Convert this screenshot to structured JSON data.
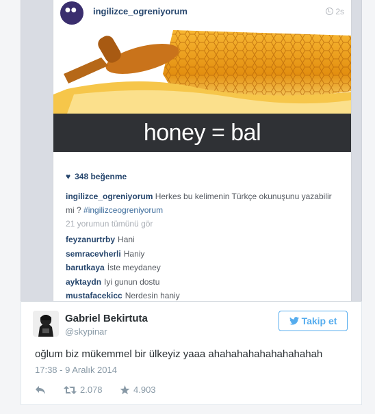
{
  "instagram": {
    "username": "ingilizce_ogreniyorum",
    "time": "2s",
    "image_text": "honey = bal",
    "likes": "348 beğenme",
    "caption_user": "ingilizce_ogreniyorum",
    "caption_text": "Herkes bu kelimenin Türkçe okunuşunu yazabilir mi ?",
    "caption_hashtag": "#ingilizceogreniyorum",
    "all_comments": "21 yorumun tümünü gör",
    "comments": [
      {
        "user": "feyzanurtrby",
        "text": "Hani"
      },
      {
        "user": "semracevherli",
        "text": "Haniy"
      },
      {
        "user": "barutkaya",
        "text": "İste meydaney"
      },
      {
        "user": "ayktaydn",
        "text": "Iyi gunun dostu"
      },
      {
        "user": "mustafacekicc",
        "text": "Nerdesin haniy"
      }
    ]
  },
  "tweet": {
    "name": "Gabriel Bekirtuta",
    "handle": "@skypinar",
    "follow_label": "Takip et",
    "text": "oğlum biz mükemmel bir ülkeyiz yaaa ahahahahahahahahahah",
    "date": "17:38 - 9 Aralık 2014",
    "retweets": "2.078",
    "favorites": "4.903"
  },
  "colors": {
    "twitter_blue": "#55acee",
    "instagram_link": "#26466d",
    "banner_bg": "#2f3135"
  }
}
